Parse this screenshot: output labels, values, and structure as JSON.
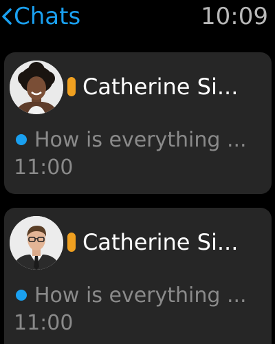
{
  "header": {
    "back_label": "Chats",
    "time": "10:09"
  },
  "chats": [
    {
      "name": "Catherine Si...",
      "preview": "How is everything ...",
      "timestamp": "11:00",
      "status_color": "#f0a020",
      "unread": true,
      "avatar": "woman-avatar"
    },
    {
      "name": "Catherine Si...",
      "preview": "How is everything ...",
      "timestamp": "11:00",
      "status_color": "#f0a020",
      "unread": true,
      "avatar": "man-avatar"
    }
  ],
  "colors": {
    "accent": "#1aa0f0",
    "status": "#f0a020",
    "card": "#262626",
    "muted": "#8a8a8a"
  }
}
